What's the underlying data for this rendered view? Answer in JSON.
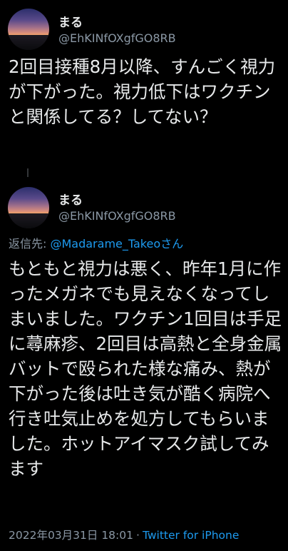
{
  "tweets": [
    {
      "display_name": "まる",
      "handle": "@EhKINfOXgfGO8RB",
      "text": "2回目接種8月以降、すんごく視力が下がった。視力低下はワクチンと関係してる？してない？"
    },
    {
      "display_name": "まる",
      "handle": "@EhKINfOXgfGO8RB",
      "reply_prefix": "返信先: ",
      "reply_mention": "@Madarame_Takeo",
      "reply_suffix": "さん",
      "text": "もともと視力は悪く、昨年1月に作ったメガネでも見えなくなってしまいました。ワクチン1回目は手足に蕁麻疹、2回目は高熱と全身金属バットで殴られた様な痛み、熱が下がった後は吐き気が酷く病院へ行き吐気止めを処方してもらいました。ホットアイマスク試してみます",
      "timestamp": "2022年03月31日 18:01",
      "separator": "·",
      "source": "Twitter for iPhone"
    }
  ],
  "colors": {
    "background": "#000000",
    "primary_text": "#e7e9ea",
    "secondary_text": "#8b98a5",
    "link": "#1d9bf0"
  },
  "icons": {
    "avatar": "sunset-sky-avatar"
  }
}
